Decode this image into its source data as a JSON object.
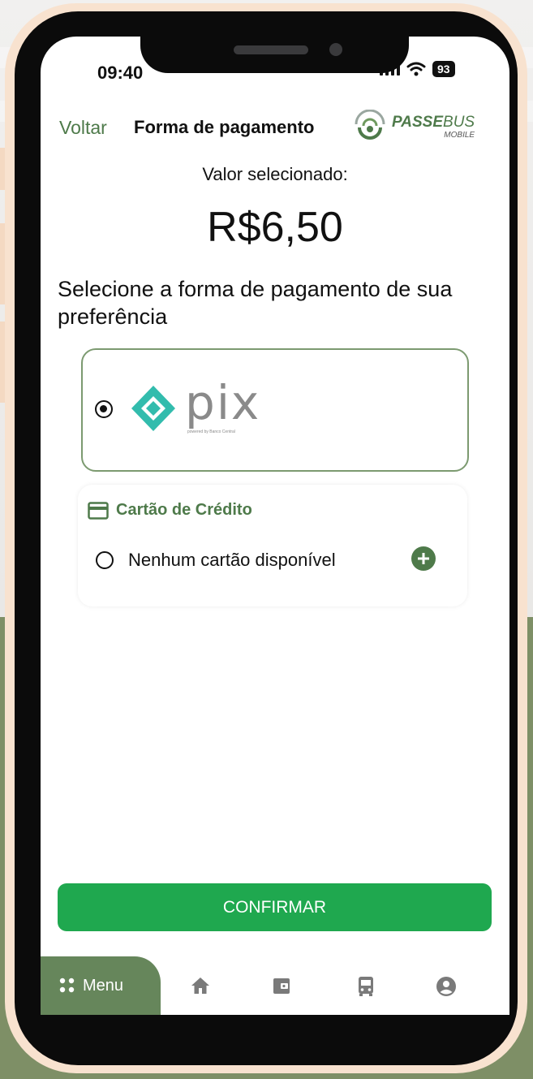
{
  "status_bar": {
    "time": "09:40",
    "battery": "93"
  },
  "header": {
    "back_label": "Voltar",
    "title": "Forma de pagamento",
    "logo_main_bold": "PASSE",
    "logo_main_light": "BUS",
    "logo_sub": "MOBILE"
  },
  "summary": {
    "value_label": "Valor selecionado:",
    "amount": "R$6,50"
  },
  "prompt": "Selecione a forma de pagamento de sua preferência",
  "payment_methods": {
    "pix": {
      "selected": true,
      "logo_text": "pix",
      "logo_tagline": "powered by Banco Central"
    },
    "credit_card": {
      "title": "Cartão de Crédito",
      "selected": false,
      "empty_label": "Nenhum cartão disponível"
    }
  },
  "confirm_label": "CONFIRMAR",
  "bottom_nav": {
    "menu_label": "Menu",
    "items": [
      "home-icon",
      "wallet-icon",
      "bus-icon",
      "profile-icon"
    ]
  },
  "colors": {
    "accent_green": "#4e7a4a",
    "confirm_green": "#1fa84f",
    "pix_teal": "#32bcad",
    "menu_green": "#66865b"
  }
}
